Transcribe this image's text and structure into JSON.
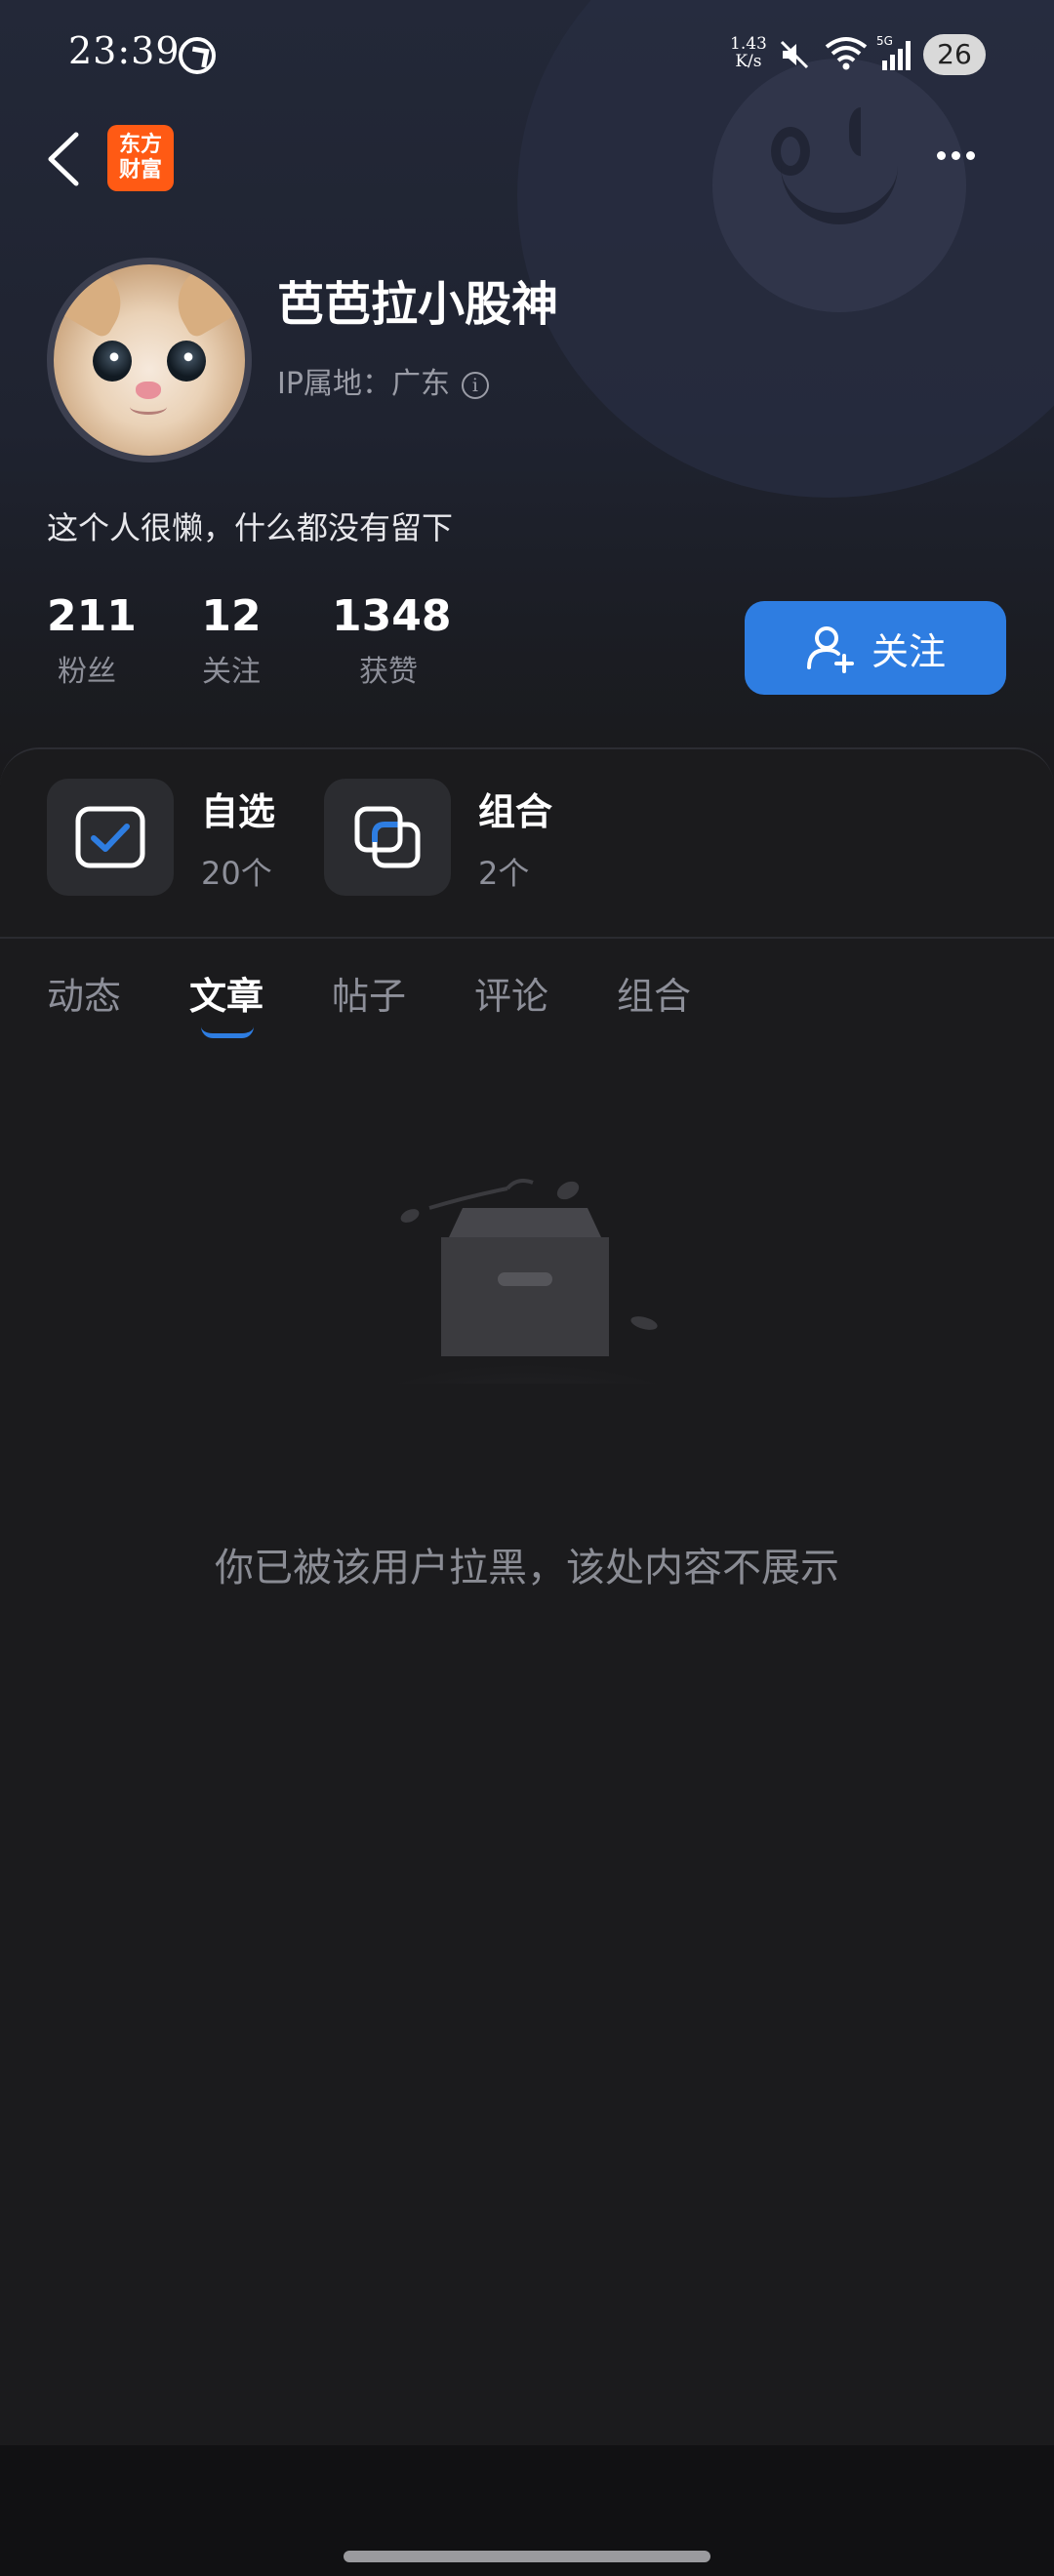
{
  "status_bar": {
    "time": "23:39",
    "net_speed_value": "1.43",
    "net_speed_unit": "K/s",
    "network_type": "5G",
    "battery": "26"
  },
  "header": {
    "logo_line1": "东方",
    "logo_line2": "财富",
    "logo_color": "#ff5a14"
  },
  "profile": {
    "username": "芭芭拉小股神",
    "ip_location": "IP属地：广东",
    "bio": "这个人很懒，什么都没有留下",
    "stats": [
      {
        "value": "211",
        "label": "粉丝"
      },
      {
        "value": "12",
        "label": "关注"
      },
      {
        "value": "1348",
        "label": "获赞"
      }
    ],
    "follow_label": "关注",
    "accent_color": "#2e7de1"
  },
  "quick_cards": [
    {
      "title": "自选",
      "count": "20个",
      "icon": "checkbox-icon"
    },
    {
      "title": "组合",
      "count": "2个",
      "icon": "overlap-squares-icon"
    }
  ],
  "tabs": [
    {
      "label": "动态",
      "active": false
    },
    {
      "label": "文章",
      "active": true
    },
    {
      "label": "帖子",
      "active": false
    },
    {
      "label": "评论",
      "active": false
    },
    {
      "label": "组合",
      "active": false
    }
  ],
  "empty_state": {
    "message": "你已被该用户拉黑，该处内容不展示",
    "icon": "empty-box-illustration"
  }
}
